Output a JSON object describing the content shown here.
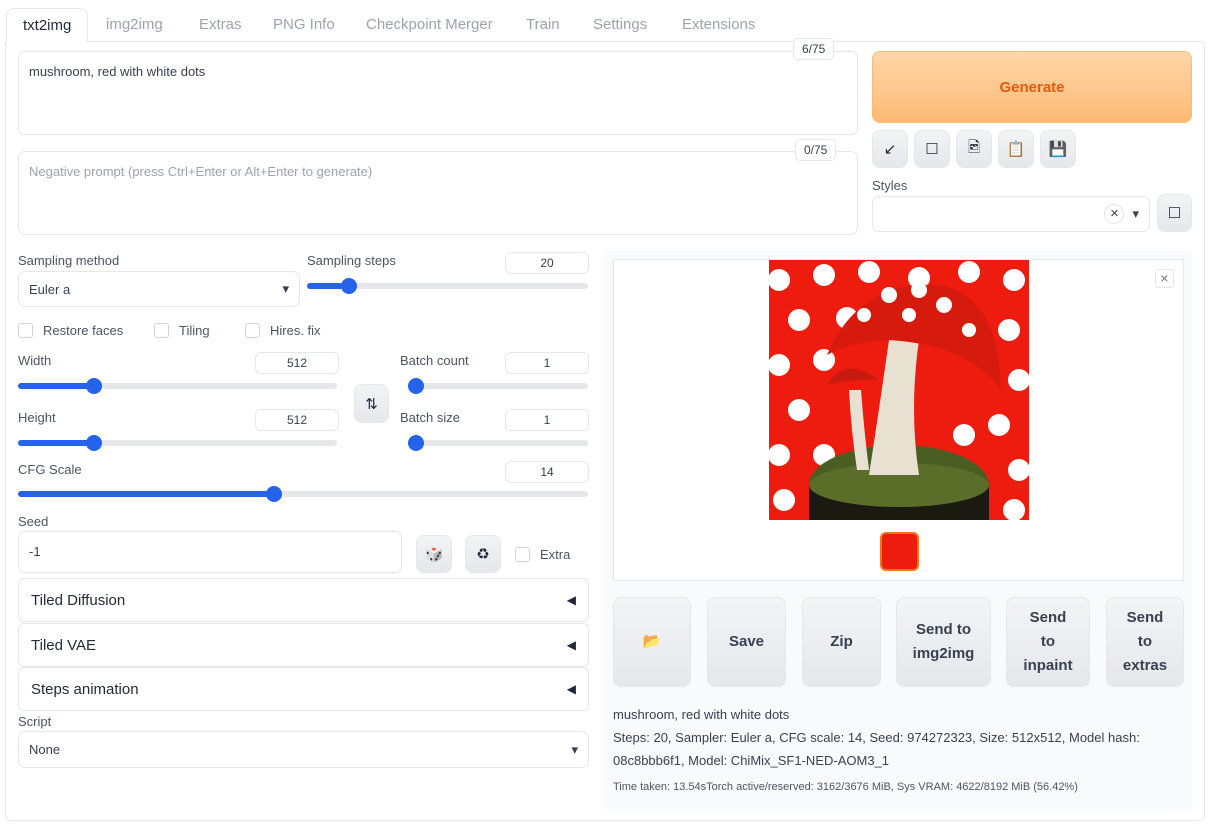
{
  "tabs": [
    "txt2img",
    "img2img",
    "Extras",
    "PNG Info",
    "Checkpoint Merger",
    "Train",
    "Settings",
    "Extensions"
  ],
  "prompt": {
    "value": "mushroom, red with white dots",
    "counter": "6/75"
  },
  "negative_prompt": {
    "placeholder": "Negative prompt (press Ctrl+Enter or Alt+Enter to generate)",
    "counter": "0/75"
  },
  "generate_label": "Generate",
  "tool_icons": [
    "arrow-down-left-icon",
    "square-icon",
    "image-icon",
    "clipboard-icon",
    "floppy-icon"
  ],
  "tool_glyphs": [
    "↙",
    "☐",
    "🖻",
    "📋",
    "💾"
  ],
  "styles": {
    "label": "Styles",
    "clear": "×",
    "caret": "▾",
    "button_glyph": "☐"
  },
  "sampling": {
    "method_label": "Sampling method",
    "method_value": "Euler a",
    "steps_label": "Sampling steps",
    "steps_value": "20",
    "steps_fraction": 0.128
  },
  "checkboxes": {
    "restore_faces": "Restore faces",
    "tiling": "Tiling",
    "hires": "Hires. fix",
    "extra": "Extra"
  },
  "width": {
    "label": "Width",
    "value": "512",
    "fraction": 0.226
  },
  "height": {
    "label": "Height",
    "value": "512",
    "fraction": 0.226
  },
  "batch_count": {
    "label": "Batch count",
    "value": "1",
    "fraction": 0
  },
  "batch_size": {
    "label": "Batch size",
    "value": "1",
    "fraction": 0
  },
  "cfg": {
    "label": "CFG Scale",
    "value": "14",
    "fraction": 0.448
  },
  "swap_glyph": "⇅",
  "seed": {
    "label": "Seed",
    "value": "-1",
    "dice": "🎲",
    "recycle": "♻"
  },
  "accordions": [
    "Tiled Diffusion",
    "Tiled VAE",
    "Steps animation"
  ],
  "accordion_arrow": "◀",
  "script": {
    "label": "Script",
    "value": "None"
  },
  "output_buttons": {
    "folder": "📂",
    "save": "Save",
    "zip": "Zip",
    "img2img": "Send to img2img",
    "inpaint": "Send to inpaint",
    "extras": "Send to extras"
  },
  "close_glyph": "×",
  "info": {
    "prompt": "mushroom, red with white dots",
    "params1": "Steps: 20, Sampler: Euler a, CFG scale: 14, Seed: 974272323, Size: 512x512, Model hash:",
    "params2": "08c8bbb6f1, Model: ChiMix_SF1-NED-AOM3_1",
    "time": "Time taken: 13.54sTorch active/reserved: 3162/3676 MiB, Sys VRAM: 4622/8192 MiB (56.42%)"
  }
}
